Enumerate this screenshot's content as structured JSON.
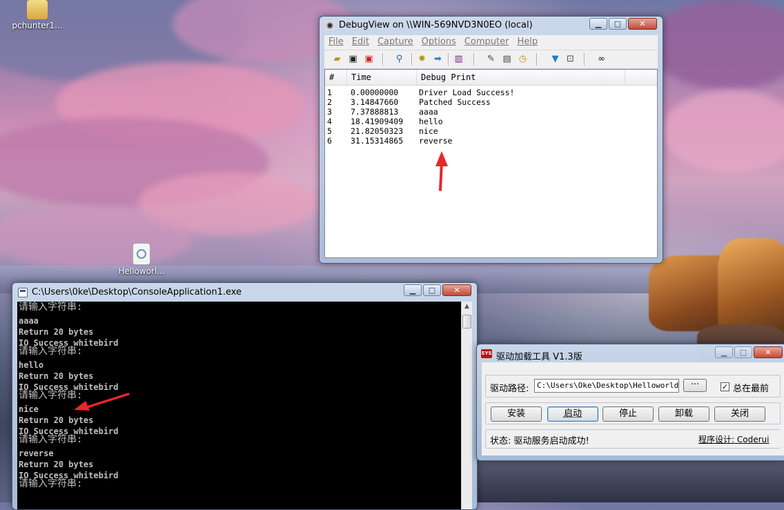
{
  "desktop": {
    "icons": [
      {
        "label": "pchunter1..."
      },
      {
        "label": "Helloworl..."
      }
    ]
  },
  "debugview": {
    "title": "DebugView on \\\\WIN-569NVD3N0EO (local)",
    "menu": [
      "File",
      "Edit",
      "Capture",
      "Options",
      "Computer",
      "Help"
    ],
    "columns": [
      "#",
      "Time",
      "Debug Print"
    ],
    "rows": [
      {
        "n": "1",
        "time": "0.00000000",
        "msg": "Driver Load Success!"
      },
      {
        "n": "2",
        "time": "3.14847660",
        "msg": "Patched Success"
      },
      {
        "n": "3",
        "time": "7.37888813",
        "msg": "aaaa"
      },
      {
        "n": "4",
        "time": "18.41909409",
        "msg": "hello"
      },
      {
        "n": "5",
        "time": "21.82050323",
        "msg": "nice"
      },
      {
        "n": "6",
        "time": "31.15314865",
        "msg": "reverse"
      }
    ],
    "toolbar_icons": [
      "open-icon",
      "save-icon",
      "clear-icon",
      "capture-icon",
      "find-icon",
      "highlight-icon",
      "autoscroll-icon",
      "clock-icon",
      "log-icon",
      "history-icon",
      "timer-icon",
      "filter-icon",
      "computer-icon",
      "binoculars-icon"
    ]
  },
  "console": {
    "title": "C:\\Users\\0ke\\Desktop\\ConsoleApplication1.exe",
    "lines": [
      "请输入字符串:",
      "aaaa",
      "Return 20 bytes",
      "IO Success whitebird",
      "请输入字符串:",
      "hello",
      "Return 20 bytes",
      "IO Success whitebird",
      "请输入字符串:",
      "nice",
      "Return 20 bytes",
      "IO Success whitebird",
      "请输入字符串:",
      "reverse",
      "Return 20 bytes",
      "IO Success whitebird",
      "请输入字符串:"
    ]
  },
  "loader": {
    "title": "驱动加载工具 V1.3版",
    "icon_text": "SYS",
    "path_label": "驱动路径:",
    "path_value": "C:\\Users\\Oke\\Desktop\\Helloworld.sy",
    "browse_label": "···",
    "topmost_label": "总在最前",
    "topmost_checked": true,
    "buttons": {
      "install": "安装",
      "start": "启动",
      "stop": "停止",
      "uninstall": "卸载",
      "close": "关闭"
    },
    "status": "状态: 驱动服务启动成功!",
    "credit": "程序设计: Coderui"
  },
  "colors": {
    "arrow": "#e8262b",
    "console_text": "#c0c0c0"
  }
}
